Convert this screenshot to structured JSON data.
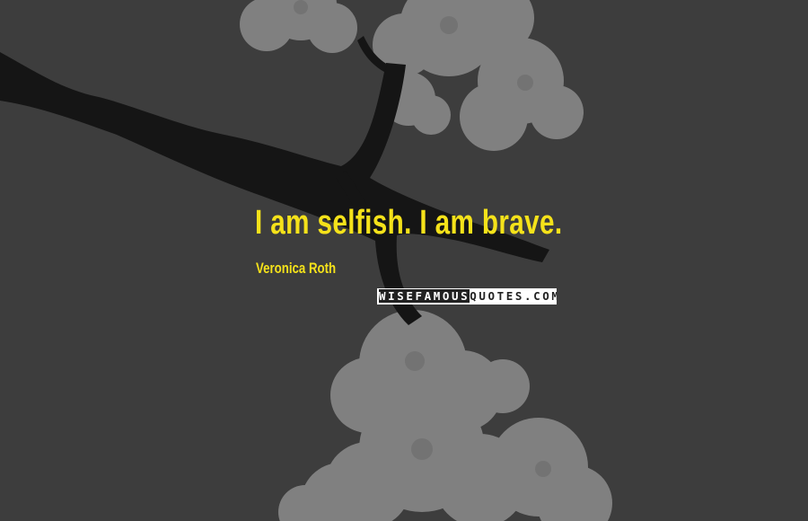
{
  "quote": {
    "text": "I am selfish. I am brave.",
    "author": "Veronica Roth"
  },
  "watermark": {
    "lead": "WISEFAMOUS",
    "rest": "QUOTES.COM"
  },
  "colors": {
    "background": "#3d3d3d",
    "quote_text": "#f5e21a",
    "branch": "#141414",
    "blossom": "#bdbdbd"
  },
  "icons": [
    "branch-illustration",
    "blossom-illustration"
  ]
}
